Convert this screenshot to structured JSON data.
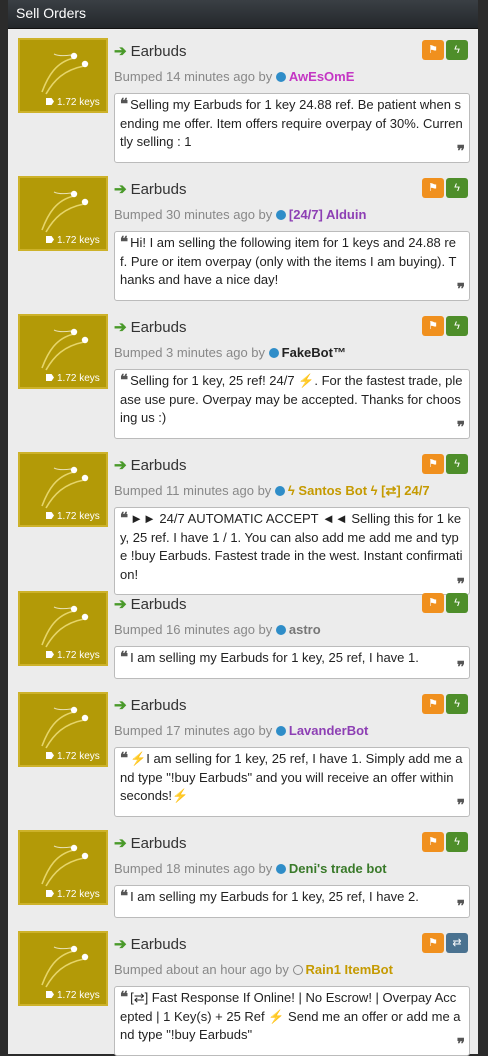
{
  "header": {
    "title": "Sell Orders"
  },
  "common": {
    "price": "1.72 keys",
    "item_name": "Earbuds",
    "bumped_prefix": "Bumped",
    "by": "by",
    "flag_glyph": "⚑",
    "bolt_glyph": "ϟ",
    "swap_glyph": "⇄",
    "arrow_glyph": "➔",
    "quote_open": "❝",
    "quote_close": "❞"
  },
  "orders": [
    {
      "time": "14 minutes ago",
      "user": "AwEsOmE",
      "user_color": "#c436c4",
      "status": "online",
      "message": "Selling my Earbuds for 1 key 24.88 ref. Be patient when sending me offer. Item offers require overpay of 30%. Currently selling : 1",
      "action": "bolt"
    },
    {
      "time": "30 minutes ago",
      "user": "[24/7] Alduin",
      "user_color": "#8d3fb4",
      "status": "online",
      "message": "Hi! I am selling the following item for 1 keys and 24.88 ref. Pure or item overpay (only with the items I am buying). Thanks and have a nice day!",
      "action": "bolt"
    },
    {
      "time": "3 minutes ago",
      "user": "FakeBot™",
      "user_color": "#222222",
      "status": "online",
      "message": "Selling for 1 key, 25 ref! 24/7 ⚡. For the fastest trade, please use pure. Overpay may be accepted. Thanks for choosing us :)",
      "action": "bolt"
    },
    {
      "time": "11 minutes ago",
      "user": "ϟ Santos Bot ϟ [⇄] 24/7",
      "user_color": "#c59a00",
      "status": "online",
      "message": "►► 24/7 AUTOMATIC ACCEPT ◄◄ Selling this for 1 key, 25 ref. I have 1 / 1. You can also add me add me and type !buy Earbuds. Fastest trade in the west. Instant confirmation!",
      "action": "bolt"
    },
    {
      "time": "16 minutes ago",
      "user": "astro",
      "user_color": "#777777",
      "status": "online",
      "message": "I am selling my Earbuds for 1 key, 25 ref, I have 1.",
      "action": "bolt"
    },
    {
      "time": "17 minutes ago",
      "user": "LavanderBot",
      "user_color": "#8d3fb4",
      "status": "online",
      "message": "⚡I am selling for 1 key, 25 ref, I have 1. Simply add me and type \"!buy Earbuds\" and you will receive an offer within seconds!⚡",
      "action": "bolt"
    },
    {
      "time": "18 minutes ago",
      "user": "Deni's trade bot",
      "user_color": "#3a7a2a",
      "status": "online",
      "message": "I am selling my Earbuds for 1 key, 25 ref, I have 2.",
      "action": "bolt"
    },
    {
      "time": "about an hour ago",
      "user": "Rain1 ItemBot",
      "user_color": "#c59a00",
      "status": "offline",
      "message": "[⇄] Fast Response If Online! | No Escrow! | Overpay Accepted | 1 Key(s) + 25 Ref ⚡ Send me an offer or add me and type \"!buy Earbuds\"",
      "action": "swap"
    }
  ]
}
